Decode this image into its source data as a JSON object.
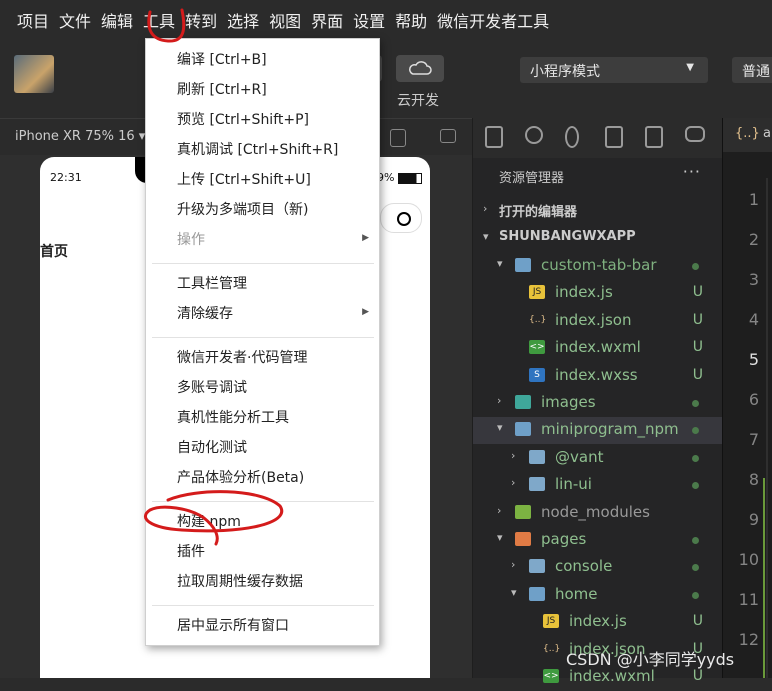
{
  "menubar": {
    "items": [
      "项目",
      "文件",
      "编辑",
      "工具",
      "转到",
      "选择",
      "视图",
      "界面",
      "设置",
      "帮助",
      "微信开发者工具"
    ]
  },
  "toolbar": {
    "cloud_label": "云开发",
    "mode_select": "小程序模式",
    "normal_button": "普通"
  },
  "simulator": {
    "device": "iPhone XR 75% 16 ▾",
    "time": "22:31",
    "battery": "9%",
    "page_title": "首页"
  },
  "explorer": {
    "title": "资源管理器",
    "more": "···",
    "open_editors": "打开的编辑器",
    "project": "SHUNBANGWXAPP"
  },
  "tree": [
    {
      "label": "custom-tab-bar",
      "kind": "folder-open",
      "level": 1,
      "chev": "▾",
      "color": "#7fb07f",
      "dot": true
    },
    {
      "label": "index.js",
      "kind": "js",
      "level": 2,
      "status": "U",
      "color": "#8fbf8f"
    },
    {
      "label": "index.json",
      "kind": "json",
      "level": 2,
      "status": "U",
      "color": "#8fbf8f"
    },
    {
      "label": "index.wxml",
      "kind": "wxml",
      "level": 2,
      "status": "U",
      "color": "#8fbf8f"
    },
    {
      "label": "index.wxss",
      "kind": "wxss",
      "level": 2,
      "status": "U",
      "color": "#8fbf8f"
    },
    {
      "label": "images",
      "kind": "folder-img",
      "level": 1,
      "chev": "›",
      "color": "#8fbf8f",
      "dot": true
    },
    {
      "label": "miniprogram_npm",
      "kind": "folder-open",
      "level": 1,
      "chev": "▾",
      "color": "#8fbf8f",
      "dot": true,
      "selected": true
    },
    {
      "label": "@vant",
      "kind": "folder",
      "level": 2,
      "chev": "›",
      "color": "#8fbf8f",
      "dot": true
    },
    {
      "label": "lin-ui",
      "kind": "folder",
      "level": 2,
      "chev": "›",
      "color": "#8fbf8f",
      "dot": true
    },
    {
      "label": "node_modules",
      "kind": "folder-node",
      "level": 1,
      "chev": "›",
      "color": "#999999"
    },
    {
      "label": "pages",
      "kind": "folder-pages",
      "level": 1,
      "chev": "▾",
      "color": "#8fbf8f",
      "dot": true
    },
    {
      "label": "console",
      "kind": "folder",
      "level": 2,
      "chev": "›",
      "color": "#8fbf8f",
      "dot": true
    },
    {
      "label": "home",
      "kind": "folder-open",
      "level": 2,
      "chev": "▾",
      "color": "#8fbf8f",
      "dot": true
    },
    {
      "label": "index.js",
      "kind": "js",
      "level": 3,
      "status": "U",
      "color": "#8fbf8f"
    },
    {
      "label": "index.json",
      "kind": "json",
      "level": 3,
      "status": "U",
      "color": "#8fbf8f"
    },
    {
      "label": "index.wxml",
      "kind": "wxml",
      "level": 3,
      "status": "U",
      "color": "#8fbf8f"
    }
  ],
  "editor": {
    "tab_icon": "{..}",
    "tab_label": "a",
    "line_numbers": [
      "1",
      "2",
      "3",
      "4",
      "5",
      "6",
      "7",
      "8",
      "9",
      "10",
      "11",
      "12"
    ]
  },
  "tools_menu": {
    "groups": [
      [
        {
          "label": "编译  [Ctrl+B]"
        },
        {
          "label": "刷新  [Ctrl+R]"
        },
        {
          "label": "预览  [Ctrl+Shift+P]"
        },
        {
          "label": "真机调试  [Ctrl+Shift+R]"
        },
        {
          "label": "上传  [Ctrl+Shift+U]"
        },
        {
          "label": "升级为多端项目（新)"
        },
        {
          "label": "操作",
          "disabled": true,
          "submenu": true
        }
      ],
      [
        {
          "label": "工具栏管理"
        },
        {
          "label": "清除缓存",
          "submenu": true
        }
      ],
      [
        {
          "label": "微信开发者·代码管理"
        },
        {
          "label": "多账号调试"
        },
        {
          "label": "真机性能分析工具"
        },
        {
          "label": "自动化测试"
        },
        {
          "label": "产品体验分析(Beta)"
        }
      ],
      [
        {
          "label": "构建 npm"
        },
        {
          "label": "插件"
        },
        {
          "label": "拉取周期性缓存数据"
        }
      ],
      [
        {
          "label": "居中显示所有窗口"
        }
      ]
    ]
  },
  "watermark": "CSDN @小李同学yyds",
  "annotation_color": "#d41b1b"
}
